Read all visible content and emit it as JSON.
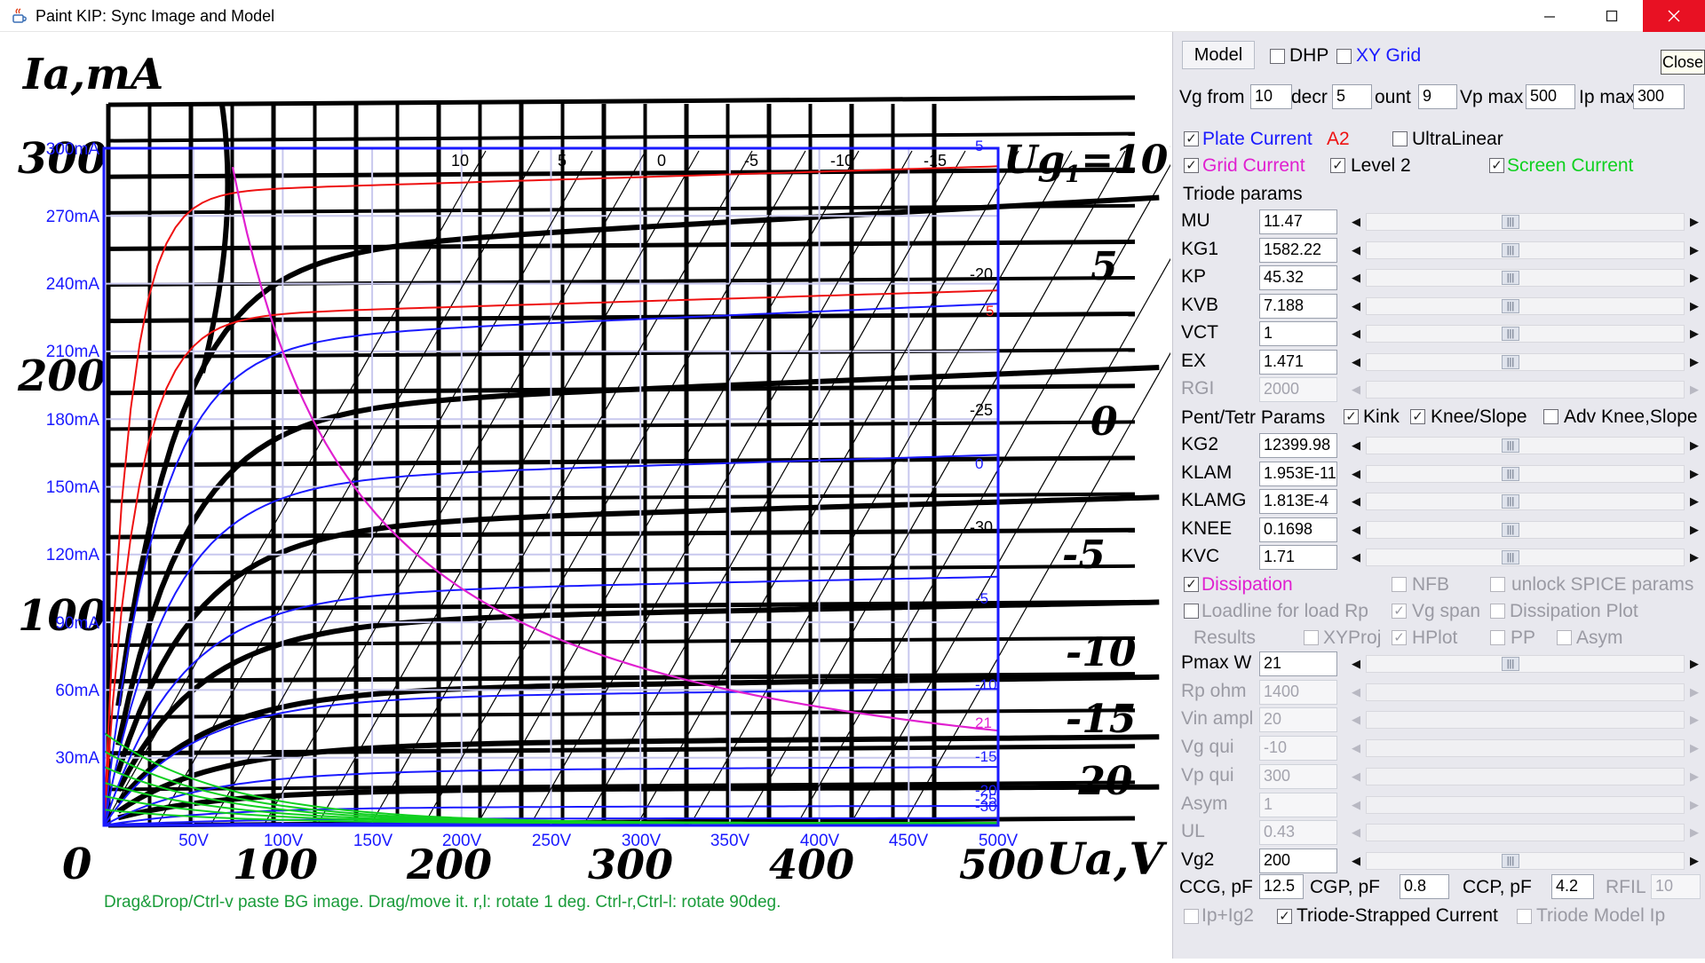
{
  "window": {
    "title": "Paint KIP: Sync Image and Model",
    "app_icon": "java-cup-icon",
    "minimize_icon": "minimize-icon",
    "maximize_icon": "maximize-icon",
    "close_icon": "close-icon",
    "close_tooltip": "Close"
  },
  "bg_image": {
    "y_title": "Ia,mA",
    "x_title": "Ua,V",
    "zero": "0",
    "y_labels": [
      "300",
      "200",
      "100"
    ],
    "x_labels": [
      "100",
      "200",
      "300",
      "400",
      "500"
    ],
    "grid_label_prefix": "Ug",
    "grid_label_sub": "1",
    "grid_label_value": "=10V",
    "curve_labels": [
      "5",
      "0",
      "-5",
      "-10",
      "-15",
      "-20"
    ]
  },
  "plot": {
    "y_tick_labels": [
      "300mA",
      "270mA",
      "240mA",
      "210mA",
      "180mA",
      "150mA",
      "120mA",
      "90mA",
      "60mA",
      "30mA"
    ],
    "x_tick_labels": [
      "50V",
      "100V",
      "150V",
      "200V",
      "250V",
      "300V",
      "350V",
      "400V",
      "450V",
      "500V"
    ],
    "grid_top_labels": [
      "10",
      "5",
      "0",
      "-5",
      "-10",
      "-15"
    ],
    "grid_right_labels": [
      "-20",
      "-25",
      "-30"
    ],
    "curve_end_labels_blue": [
      "5",
      "0",
      "-5",
      "-10",
      "-15",
      "-20",
      "-25",
      "-30"
    ],
    "red_curve_end_label": "5",
    "pink_curve_end_label": "21",
    "status_hint": "Drag&Drop/Ctrl-v paste BG image. Drag/move it. r,l: rotate 1 deg. Ctrl-r,Ctrl-l: rotate 90deg."
  },
  "panel": {
    "model_button": "Model",
    "dhp": {
      "label": "DHP",
      "checked": false
    },
    "xy_grid": {
      "label": "XY Grid",
      "checked": false
    },
    "vg_from": {
      "label": "Vg from",
      "value": "10"
    },
    "decr": {
      "label": "decr",
      "value": "5"
    },
    "count": {
      "label": "ount",
      "value": "9"
    },
    "vp_max": {
      "label": "Vp max",
      "value": "500"
    },
    "ip_max": {
      "label": "Ip max",
      "value": "300"
    },
    "plate_current": {
      "label": "Plate Current",
      "checked": true
    },
    "a2_label": "A2",
    "ultralinear": {
      "label": "UltraLinear",
      "checked": false
    },
    "grid_current": {
      "label": "Grid Current",
      "checked": true
    },
    "level2": {
      "label": "Level 2",
      "checked": true
    },
    "screen_current": {
      "label": "Screen Current",
      "checked": true
    },
    "triode_header": "Triode params",
    "triode_params": [
      {
        "name": "MU",
        "value": "11.47",
        "enabled": true
      },
      {
        "name": "KG1",
        "value": "1582.22",
        "enabled": true
      },
      {
        "name": "KP",
        "value": "45.32",
        "enabled": true
      },
      {
        "name": "KVB",
        "value": "7.188",
        "enabled": true
      },
      {
        "name": "VCT",
        "value": "1",
        "enabled": true
      },
      {
        "name": "EX",
        "value": "1.471",
        "enabled": true
      },
      {
        "name": "RGI",
        "value": "2000",
        "enabled": false
      }
    ],
    "pent_header": "Pent/Tetr Params",
    "kink": {
      "label": "Kink",
      "checked": true
    },
    "knee_slope": {
      "label": "Knee/Slope",
      "checked": true
    },
    "adv_knee": {
      "label": "Adv Knee,Slope",
      "checked": false
    },
    "pent_params": [
      {
        "name": "KG2",
        "value": "12399.98",
        "enabled": true
      },
      {
        "name": "KLAM",
        "value": "1.953E-11",
        "enabled": true
      },
      {
        "name": "KLAMG",
        "value": "1.813E-4",
        "enabled": true
      },
      {
        "name": "KNEE",
        "value": "0.1698",
        "enabled": true
      },
      {
        "name": "KVC",
        "value": "1.71",
        "enabled": true
      }
    ],
    "dissipation": {
      "label": "Dissipation",
      "checked": true
    },
    "nfb": {
      "label": "NFB",
      "checked": false
    },
    "unlock_spice": {
      "label": "unlock SPICE params",
      "checked": false
    },
    "loadline": {
      "label": "Loadline for load Rp",
      "checked": false
    },
    "vg_span": {
      "label": "Vg span",
      "checked": true
    },
    "dissipation_plot": {
      "label": "Dissipation Plot",
      "checked": false
    },
    "results_label": "Results",
    "xyproj": {
      "label": "XYProj",
      "checked": false
    },
    "hplot": {
      "label": "HPlot",
      "checked": true
    },
    "pp": {
      "label": "PP",
      "checked": false
    },
    "asym_cb": {
      "label": "Asym",
      "checked": false
    },
    "load_params": [
      {
        "name": "Pmax W",
        "value": "21",
        "enabled": true
      },
      {
        "name": "Rp ohm",
        "value": "1400",
        "enabled": false
      },
      {
        "name": "Vin ampl",
        "value": "20",
        "enabled": false
      },
      {
        "name": "Vg qui",
        "value": "-10",
        "enabled": false
      },
      {
        "name": "Vp qui",
        "value": "300",
        "enabled": false
      },
      {
        "name": "Asym",
        "value": "1",
        "enabled": false
      },
      {
        "name": "UL",
        "value": "0.43",
        "enabled": false
      },
      {
        "name": "Vg2",
        "value": "200",
        "enabled": true
      }
    ],
    "ccg": {
      "label": "CCG, pF",
      "value": "12.5"
    },
    "cgp": {
      "label": "CGP, pF",
      "value": "0.8"
    },
    "ccp": {
      "label": "CCP, pF",
      "value": "4.2"
    },
    "rfil": {
      "label": "RFIL",
      "value": "10"
    },
    "ip_ig2": {
      "label": "Ip+Ig2",
      "checked": false
    },
    "triode_strapped": {
      "label": "Triode-Strapped Current",
      "checked": true
    },
    "triode_model_ip": {
      "label": "Triode Model Ip",
      "checked": false
    }
  },
  "colors": {
    "blue": "#1a1aff",
    "red": "#ee1111",
    "magenta": "#e020d0",
    "green": "#10d020",
    "grid": "#c8c8ee",
    "status_green": "#1a9c3a"
  }
}
